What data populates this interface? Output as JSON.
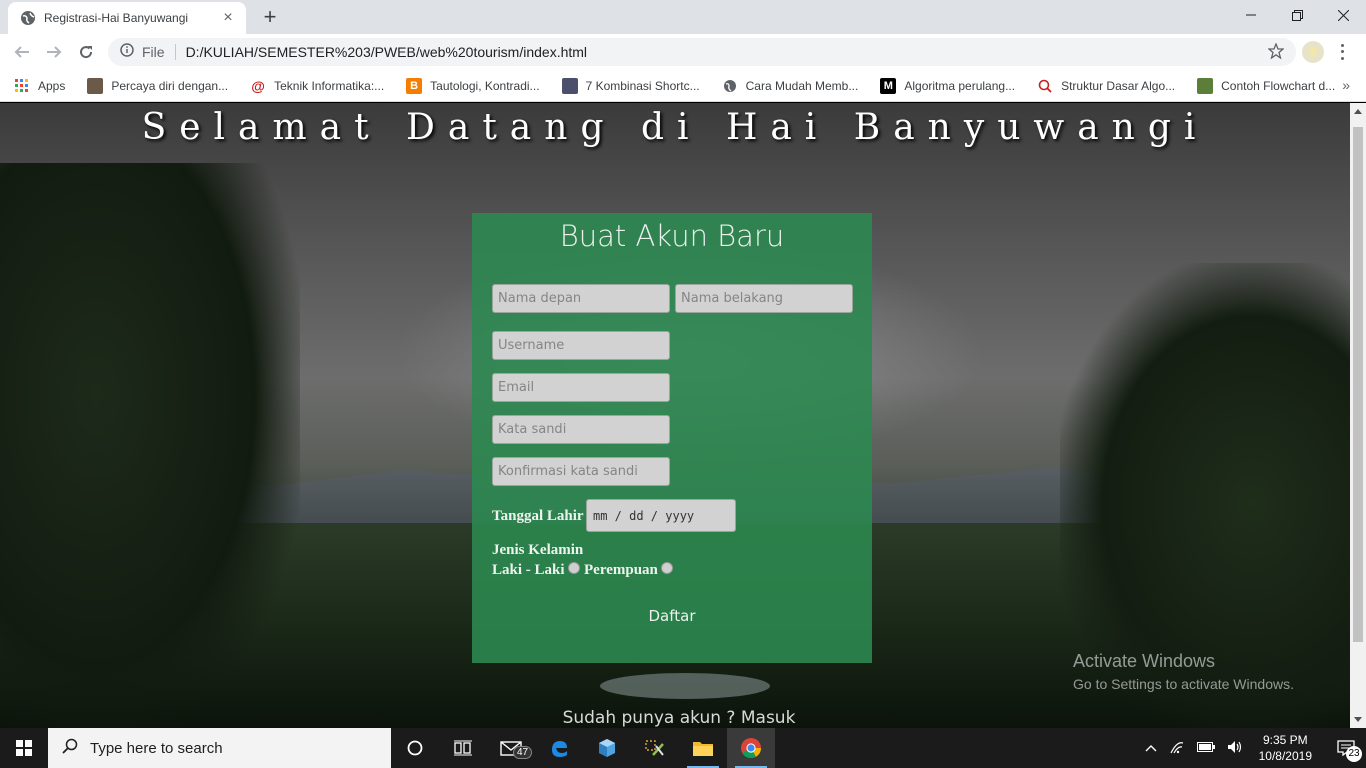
{
  "browser": {
    "tab_title": "Registrasi-Hai Banyuwangi",
    "tab_close": "×",
    "new_tab": "+",
    "file_label": "File",
    "url": "D:/KULIAH/SEMESTER%203/PWEB/web%20tourism/index.html",
    "bookmarks": [
      {
        "label": "Apps",
        "icon": "apps-grid-icon"
      },
      {
        "label": "Percaya diri dengan...",
        "icon": "thumbnail-icon"
      },
      {
        "label": "Teknik Informatika:...",
        "icon": "at-sign-icon"
      },
      {
        "label": "Tautologi, Kontradi...",
        "icon": "blogger-icon"
      },
      {
        "label": "7 Kombinasi Shortc...",
        "icon": "thumbnail-icon"
      },
      {
        "label": "Cara Mudah Memb...",
        "icon": "globe-icon"
      },
      {
        "label": "Algoritma perulang...",
        "icon": "medium-icon"
      },
      {
        "label": "Struktur Dasar Algo...",
        "icon": "search-icon"
      },
      {
        "label": "Contoh Flowchart d...",
        "icon": "sheet-icon"
      }
    ],
    "bookmarks_more": "»"
  },
  "page": {
    "title": "Selamat Datang di Hai Banyuwangi",
    "form": {
      "heading": "Buat Akun Baru",
      "first_name_placeholder": "Nama depan",
      "last_name_placeholder": "Nama belakang",
      "username_placeholder": "Username",
      "email_placeholder": "Email",
      "password_placeholder": "Kata sandi",
      "confirm_password_placeholder": "Konfirmasi kata sandi",
      "birthdate_label": "Tanggal Lahir",
      "birthdate_placeholder": "mm / dd / yyyy",
      "gender_label": "Jenis Kelamin",
      "gender_male": "Laki - Laki",
      "gender_female": "Perempuan",
      "submit_label": "Daftar"
    },
    "login_prompt": "Sudah punya akun ? Masuk"
  },
  "watermark": {
    "line1": "Activate Windows",
    "line2": "Go to Settings to activate Windows."
  },
  "taskbar": {
    "search_text": "Type here to search",
    "mail_badge": "47",
    "time": "9:35 PM",
    "date": "10/8/2019",
    "notification_count": "23"
  },
  "colors": {
    "form_green": "#2b8a50",
    "taskbar": "#1b1b1b",
    "tab_bar": "#dee1e6"
  }
}
